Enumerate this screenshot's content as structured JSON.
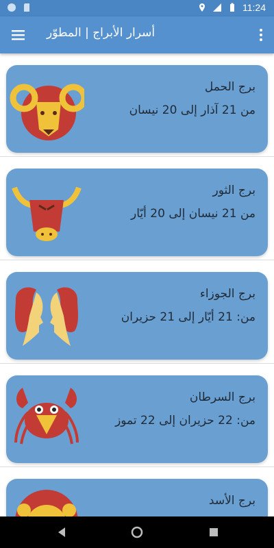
{
  "status_bar": {
    "time": "11:24",
    "left_icons": [
      "circle-icon",
      "sd-card-icon"
    ],
    "right_icons": [
      "location-icon",
      "signal-icon",
      "battery-icon"
    ]
  },
  "app_bar": {
    "title": "أسرار الأبراج | المطوّر",
    "menu_icon": "hamburger-menu-icon",
    "overflow_icon": "more-vert-icon",
    "color": "#5591cf"
  },
  "signs": [
    {
      "name": "برج الحمل",
      "dates": "من 21 آذار إلى 20 نيسان",
      "icon": "aries-ram-icon"
    },
    {
      "name": "برج الثور",
      "dates": "من 21 نيسان إلى 20 أيّار",
      "icon": "taurus-bull-icon"
    },
    {
      "name": "برج الجوزاء",
      "dates": "من: 21 أيّار إلى 21 حزيران",
      "icon": "gemini-twins-icon"
    },
    {
      "name": "برج السرطان",
      "dates": "من: 22 حزيران إلى 22 تموز",
      "icon": "cancer-crab-icon"
    },
    {
      "name": "برج الأسد",
      "dates": "",
      "icon": "leo-lion-icon"
    }
  ],
  "card_color": "#6a9fd2",
  "nav_bar": {
    "buttons": [
      "back-icon",
      "home-icon",
      "recents-icon"
    ]
  }
}
